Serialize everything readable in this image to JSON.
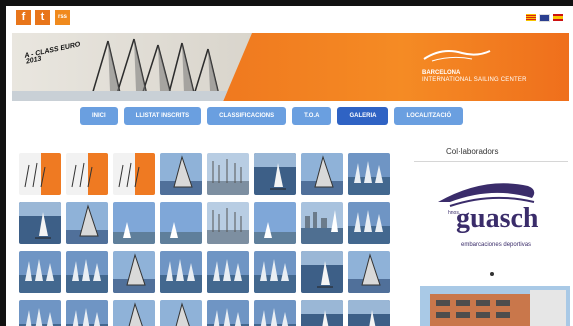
{
  "header": {
    "social": [
      "f",
      "t",
      "rss"
    ],
    "banner_title": "A - CLASS EURO",
    "banner_year": "2013",
    "logo_line1": "BARCELONA",
    "logo_line2": "INTERNATIONAL SAILING CENTER"
  },
  "nav": {
    "items": [
      "INICI",
      "LLISTAT INSCRITS",
      "CLASSIFICACIONS",
      "T.O.A",
      "GALERIA",
      "LOCALITZACIÓ"
    ],
    "active_index": 4
  },
  "sidebar": {
    "title": "Col·laboradors",
    "sponsor_small": "hnos.",
    "sponsor_name": "guasch",
    "sponsor_tagline": "embarcaciones deportivas"
  },
  "gallery": {
    "thumbnails": [
      {
        "scene": "poster"
      },
      {
        "scene": "poster"
      },
      {
        "scene": "poster"
      },
      {
        "scene": "sail-close"
      },
      {
        "scene": "harbor"
      },
      {
        "scene": "sea"
      },
      {
        "scene": "sail-close"
      },
      {
        "scene": "fleet"
      },
      {
        "scene": "sea"
      },
      {
        "scene": "sail-close"
      },
      {
        "scene": "sky"
      },
      {
        "scene": "sky"
      },
      {
        "scene": "harbor"
      },
      {
        "scene": "sky"
      },
      {
        "scene": "city"
      },
      {
        "scene": "fleet"
      },
      {
        "scene": "fleet"
      },
      {
        "scene": "fleet"
      },
      {
        "scene": "sail-close"
      },
      {
        "scene": "fleet"
      },
      {
        "scene": "fleet"
      },
      {
        "scene": "fleet"
      },
      {
        "scene": "sea"
      },
      {
        "scene": "sail-close"
      },
      {
        "scene": "fleet"
      },
      {
        "scene": "fleet"
      },
      {
        "scene": "sail-close"
      },
      {
        "scene": "sail-close"
      },
      {
        "scene": "fleet"
      },
      {
        "scene": "fleet"
      },
      {
        "scene": "sea"
      },
      {
        "scene": "sea"
      }
    ]
  }
}
